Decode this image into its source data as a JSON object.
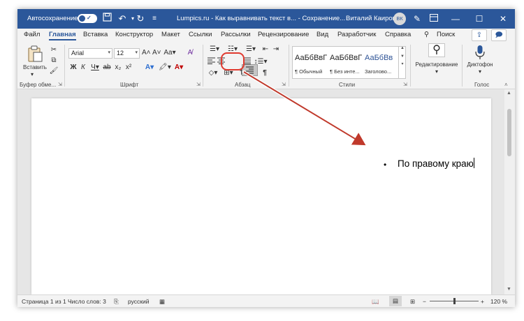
{
  "titlebar": {
    "autosave_label": "Автосохранение",
    "autosave_state": "✓",
    "document_title": "Lumpics.ru - Как выравнивать текст в... - Сохранение...",
    "user_name": "Виталий Каиров",
    "user_initials": "ВК"
  },
  "tabs": [
    {
      "label": "Файл"
    },
    {
      "label": "Главная"
    },
    {
      "label": "Вставка"
    },
    {
      "label": "Конструктор"
    },
    {
      "label": "Макет"
    },
    {
      "label": "Ссылки"
    },
    {
      "label": "Рассылки"
    },
    {
      "label": "Рецензирование"
    },
    {
      "label": "Вид"
    },
    {
      "label": "Разработчик"
    },
    {
      "label": "Справка"
    }
  ],
  "search": {
    "label": "Поиск"
  },
  "ribbon": {
    "clipboard": {
      "paste_label": "Вставить",
      "group_label": "Буфер обме..."
    },
    "font": {
      "font_name": "Arial",
      "font_size": "12",
      "group_label": "Шрифт"
    },
    "paragraph": {
      "group_label": "Абзац"
    },
    "styles": {
      "items": [
        {
          "sample": "АаБбВвГ",
          "name": "¶ Обычный"
        },
        {
          "sample": "АаБбВвГ",
          "name": "¶ Без инте..."
        },
        {
          "sample": "АаБбВв",
          "name": "Заголово..."
        }
      ],
      "group_label": "Стили"
    },
    "editing": {
      "label": "Редактирование"
    },
    "voice": {
      "label": "Диктофон",
      "group_label": "Голос"
    }
  },
  "document": {
    "bullet": "•",
    "text": "По правому краю"
  },
  "statusbar": {
    "page": "Страница 1 из 1",
    "words": "Число слов: 3",
    "language": "русский",
    "zoom": "120 %"
  },
  "colors": {
    "title_blue": "#2b579a",
    "highlight_red": "#e03a2f"
  }
}
